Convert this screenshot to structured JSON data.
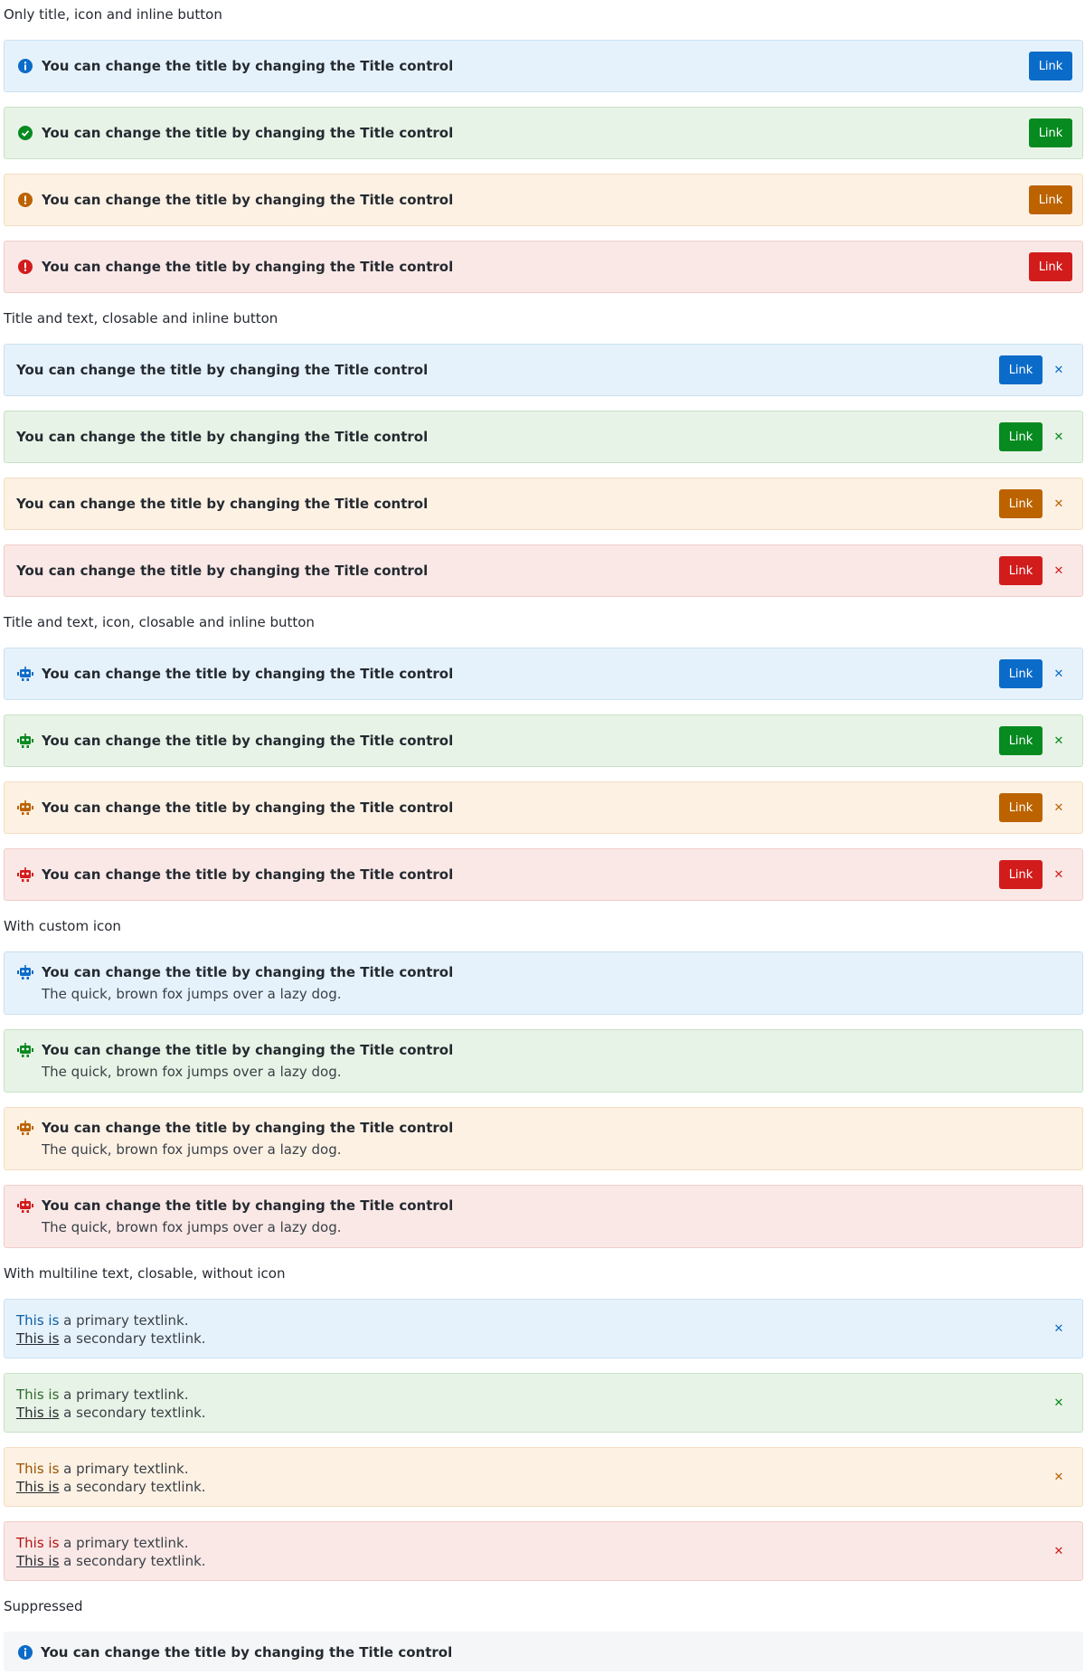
{
  "sections": {
    "s1": "Only title, icon and inline button",
    "s2": "Title and text, closable and inline button",
    "s3": "Title and text, icon, closable and inline button",
    "s4": "With custom icon",
    "s5": "With multiline text, closable, without icon",
    "s6": "Suppressed"
  },
  "alert_title": "You can change the title by changing the Title control",
  "alert_body": "The quick, brown fox jumps over a lazy dog.",
  "button_label": "Link",
  "close_glyph": "✕",
  "multiline": {
    "primary_link": "This is",
    "primary_rest": " a primary textlink.",
    "secondary_link": "This is",
    "secondary_rest": " a secondary textlink."
  },
  "colors": {
    "info": "#0b6bc9",
    "success": "#078a20",
    "warning": "#bc6300",
    "critical": "#d21c1c"
  },
  "icons": {
    "info": "information-circle-icon",
    "success": "check-circle-icon",
    "warning": "alert-circle-icon",
    "critical": "alert-circle-icon",
    "custom": "robot-icon"
  }
}
